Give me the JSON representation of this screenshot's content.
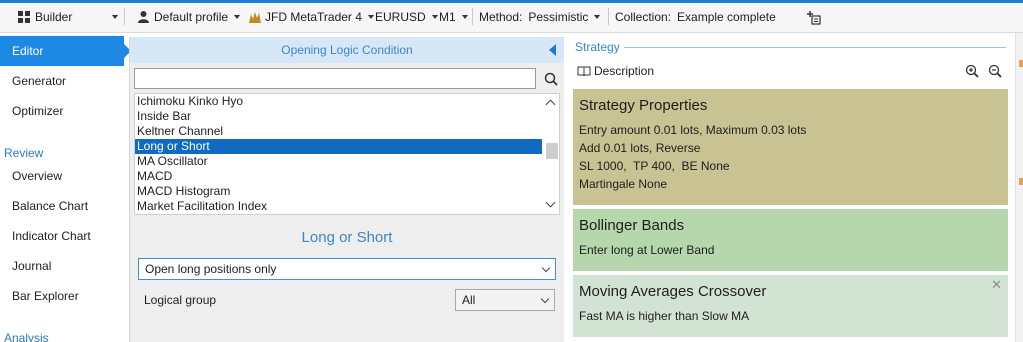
{
  "toolbar": {
    "builder": "Builder",
    "profile": "Default profile",
    "broker": "JFD MetaTrader 4",
    "symbol": "EURUSD",
    "period": "M1",
    "method_label": "Method:",
    "method_value": "Pessimistic",
    "collection_label": "Collection:",
    "collection_value": "Example complete"
  },
  "nav": {
    "editor": "Editor",
    "generator": "Generator",
    "optimizer": "Optimizer",
    "review": "Review",
    "overview": "Overview",
    "balance_chart": "Balance Chart",
    "indicator_chart": "Indicator Chart",
    "journal": "Journal",
    "bar_explorer": "Bar Explorer",
    "analysis": "Analysis"
  },
  "logic_panel": {
    "header": "Opening Logic Condition",
    "search_value": "",
    "items": [
      "Ichimoku Kinko Hyo",
      "Inside Bar",
      "Keltner Channel",
      "Long or Short",
      "MA Oscillator",
      "MACD",
      "MACD Histogram",
      "Market Facilitation Index"
    ],
    "selected_title": "Long or Short",
    "condition_value": "Open long positions only",
    "logical_group_label": "Logical group",
    "logical_group_value": "All"
  },
  "strategy": {
    "title": "Strategy",
    "description_label": "Description",
    "cards": [
      {
        "title": "Strategy Properties",
        "lines": [
          "Entry amount 0.01 lots, Maximum 0.03 lots",
          "Add 0.01 lots, Reverse",
          "SL 1000,  TP 400,  BE None",
          "Martingale None"
        ],
        "color": "#c9c293"
      },
      {
        "title": "Bollinger Bands",
        "lines": [
          "Enter long at Lower Band"
        ],
        "color": "#b6d6ac"
      },
      {
        "title": "Moving Averages Crossover",
        "lines": [
          "Fast MA is higher than Slow MA"
        ],
        "color": "#d2e3d3"
      }
    ],
    "close_glyph": "✕"
  },
  "colors": {
    "accent": "#1e88e5",
    "selected": "#0f6ac0",
    "link": "#3b86c8"
  }
}
